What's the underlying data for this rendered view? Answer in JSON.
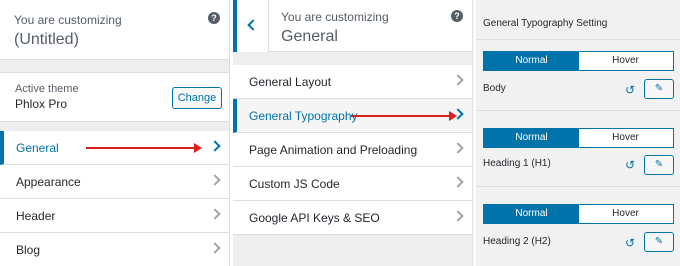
{
  "panel_left": {
    "header": {
      "small": "You are customizing",
      "big": "(Untitled)"
    },
    "theme": {
      "label": "Active theme",
      "name": "Phlox Pro",
      "change_label": "Change"
    },
    "sections": [
      {
        "label": "General"
      },
      {
        "label": "Appearance"
      },
      {
        "label": "Header"
      },
      {
        "label": "Blog"
      }
    ]
  },
  "panel_middle": {
    "header": {
      "small": "You are customizing",
      "big": "General"
    },
    "sections": [
      {
        "label": "General Layout"
      },
      {
        "label": "General Typography"
      },
      {
        "label": "Page Animation and Preloading"
      },
      {
        "label": "Custom JS Code"
      },
      {
        "label": "Google API Keys & SEO"
      }
    ]
  },
  "panel_right": {
    "title": "General Typography Setting",
    "tabs": {
      "normal": "Normal",
      "hover": "Hover"
    },
    "settings": [
      {
        "label": "Body"
      },
      {
        "label": "Heading 1 (H1)"
      },
      {
        "label": "Heading 2 (H2)"
      }
    ]
  },
  "icons": {
    "help": "question-circle-icon",
    "chevron": "chevron-right-icon",
    "back": "chevron-left-icon",
    "reset": "undo-icon",
    "edit": "pencil-icon"
  },
  "colors": {
    "accent": "#0073aa",
    "annotation_arrow": "#d9221c"
  }
}
